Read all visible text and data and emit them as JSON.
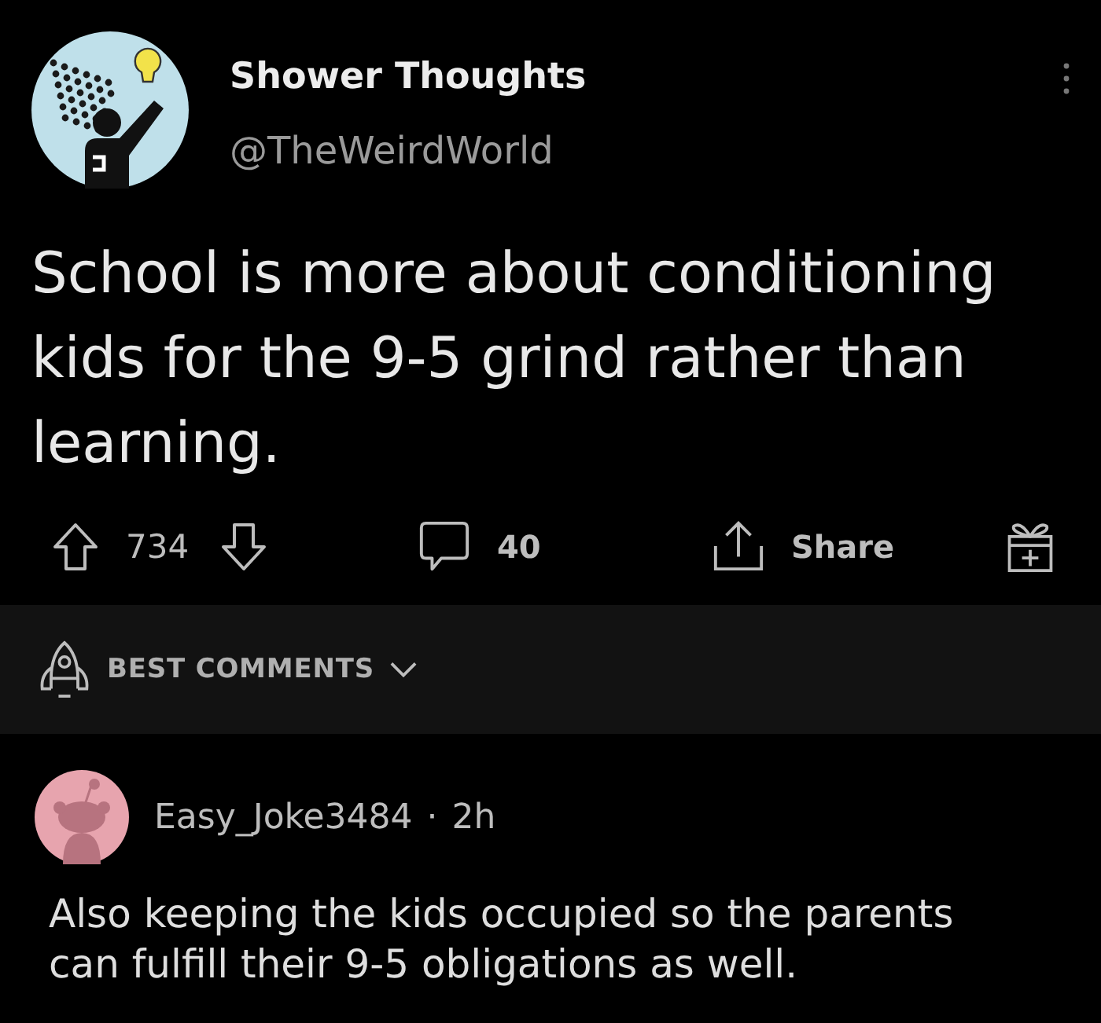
{
  "post": {
    "author": {
      "name": "Shower Thoughts",
      "handle": "@TheWeirdWorld"
    },
    "text": "School is more about conditioning kids for the 9-5 grind rather than learning.",
    "actions": {
      "score": "734",
      "comments": "40",
      "share": "Share"
    }
  },
  "sort": {
    "label": "BEST COMMENTS"
  },
  "comments": [
    {
      "author": "Easy_Joke3484",
      "separator": "·",
      "time": "2h",
      "text": "Also keeping the kids occupied so the parents can fulfill their 9-5 obligations as well."
    }
  ]
}
